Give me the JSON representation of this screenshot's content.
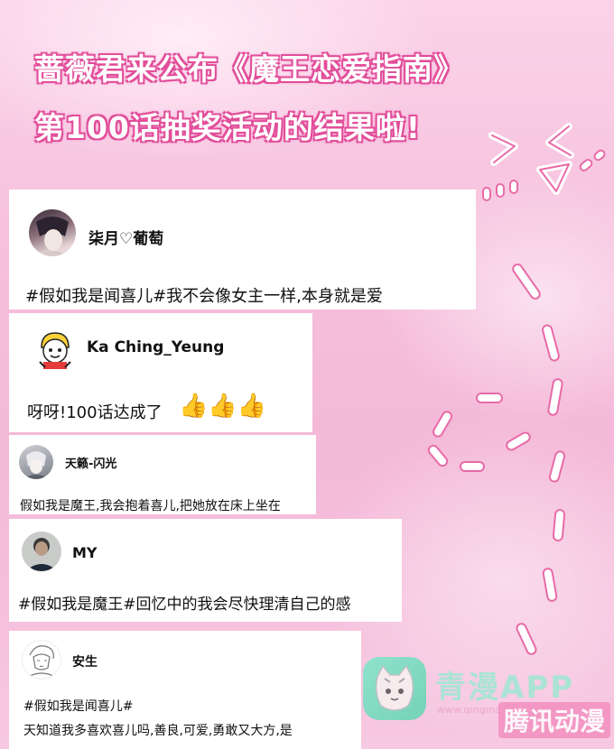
{
  "header": {
    "line1": "蔷薇君来公布《魔王恋爱指南》",
    "line2": "第100话抽奖活动的结果啦!"
  },
  "comments": [
    {
      "username": "柒月♡葡萄",
      "text": "#假如我是闻喜儿#我不会像女主一样,本身就是爱"
    },
    {
      "username": "Ka Ching_Yeung",
      "text": "呀呀!100话达成了"
    },
    {
      "username": "天籁-闪光",
      "text": "假如我是魔王,我会抱着喜儿,把她放在床上坐在"
    },
    {
      "username": "MY",
      "text": "#假如我是魔王#回忆中的我会尽快理清自己的感"
    },
    {
      "username": "安生",
      "text": "#假如我是闻喜儿#",
      "text2": "天知道我多喜欢喜儿吗,善良,可爱,勇敢又大方,是"
    }
  ],
  "emoji": {
    "thumbs": "👍👍👍"
  },
  "watermark": {
    "brand": "青漫APP",
    "sub": "腾讯动漫",
    "url": "www.qingmanapp.com"
  },
  "colors": {
    "accent": "#e24f9b",
    "background": "#f6bfdd",
    "card": "#ffffff"
  }
}
